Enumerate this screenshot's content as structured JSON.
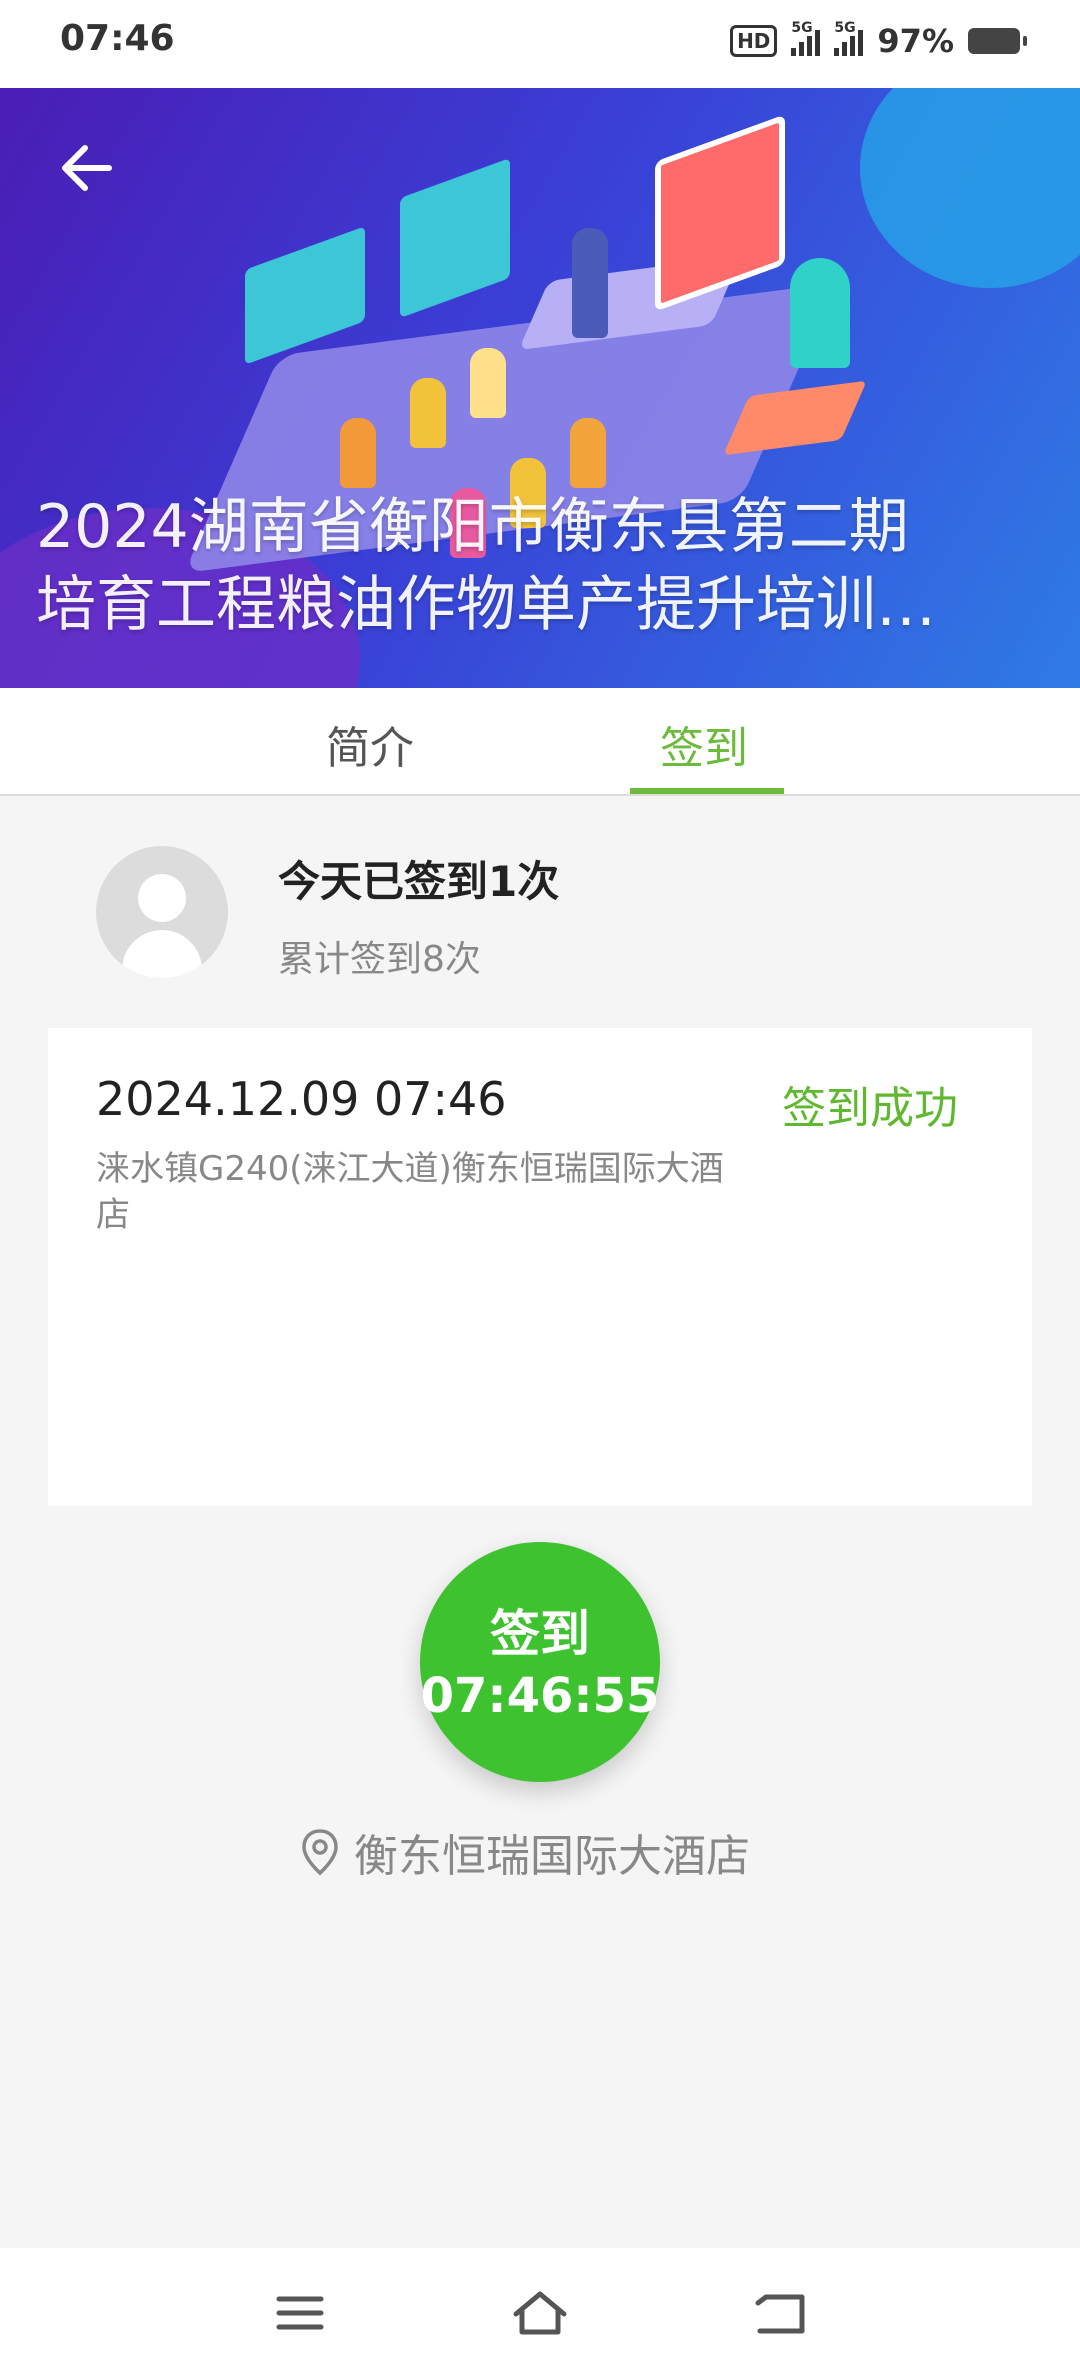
{
  "status_bar": {
    "time": "07:46",
    "hd_label": "HD",
    "sim1_label": "5G",
    "sim2_label": "5G",
    "battery": "97%"
  },
  "banner": {
    "title_line1": "2024湖南省衡阳市衡东县第二期",
    "title_line2": "培育工程粮油作物单产提升培训…",
    "back_icon": "arrow-left-icon"
  },
  "tabs": [
    {
      "label": "简介",
      "active": false
    },
    {
      "label": "签到",
      "active": true
    }
  ],
  "user": {
    "today_text": "今天已签到1次",
    "total_text": "累计签到8次"
  },
  "record": {
    "datetime": "2024.12.09 07:46",
    "status": "签到成功",
    "address": "涞水镇G240(涞江大道)衡东恒瑞国际大酒店"
  },
  "checkin": {
    "label": "签到",
    "clock": "07:46:55"
  },
  "location": {
    "name": "衡东恒瑞国际大酒店",
    "icon": "location-pin-icon"
  },
  "colors": {
    "accent_green": "#6cbb3c",
    "button_green": "#3ec22f",
    "status_green": "#5fb82e"
  },
  "navbar": {
    "icons": [
      "menu-icon",
      "home-icon",
      "back-icon"
    ]
  }
}
